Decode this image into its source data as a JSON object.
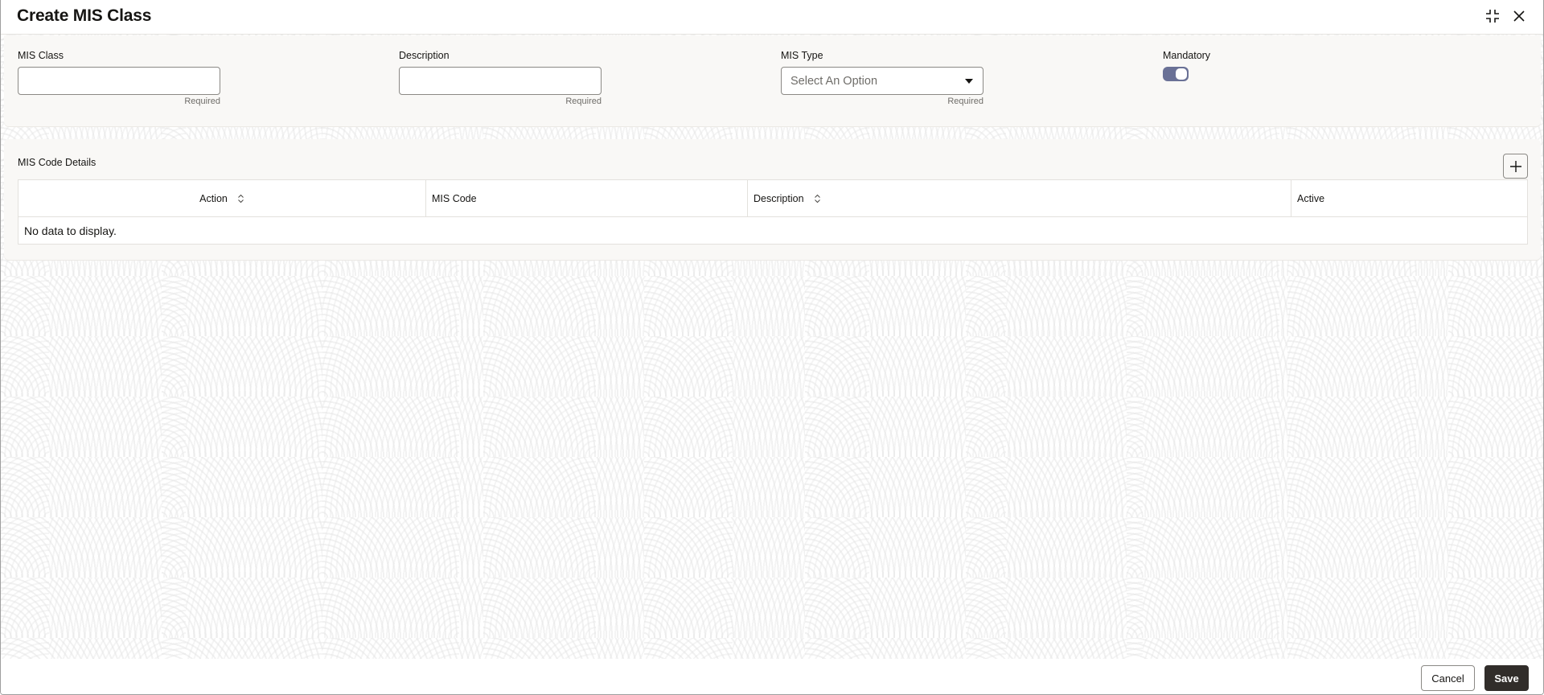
{
  "dialog": {
    "title": "Create MIS Class",
    "header_icons": {
      "collapse": "collapse-icon",
      "close": "close-icon"
    }
  },
  "form": {
    "mis_class": {
      "label": "MIS Class",
      "value": "",
      "placeholder": "",
      "helper": "Required"
    },
    "description": {
      "label": "Description",
      "value": "",
      "placeholder": "",
      "helper": "Required"
    },
    "mis_type": {
      "label": "MIS Type",
      "selected": "Select An Option",
      "helper": "Required"
    },
    "mandatory": {
      "label": "Mandatory",
      "checked": true
    }
  },
  "code_details": {
    "title": "MIS Code Details",
    "add_icon": "plus-icon",
    "columns": [
      {
        "label": "Action",
        "sortable": true
      },
      {
        "label": "MIS Code",
        "sortable": false
      },
      {
        "label": "Description",
        "sortable": true
      },
      {
        "label": "Active",
        "sortable": false
      }
    ],
    "rows": [],
    "empty_text": "No data to display."
  },
  "footer": {
    "cancel_label": "Cancel",
    "save_label": "Save"
  },
  "colors": {
    "primary_button": "#312d2a",
    "toggle_on": "#6a7196",
    "panel_bg": "#f9f8f6",
    "text": "#161513",
    "muted_text": "#6f6d69"
  }
}
